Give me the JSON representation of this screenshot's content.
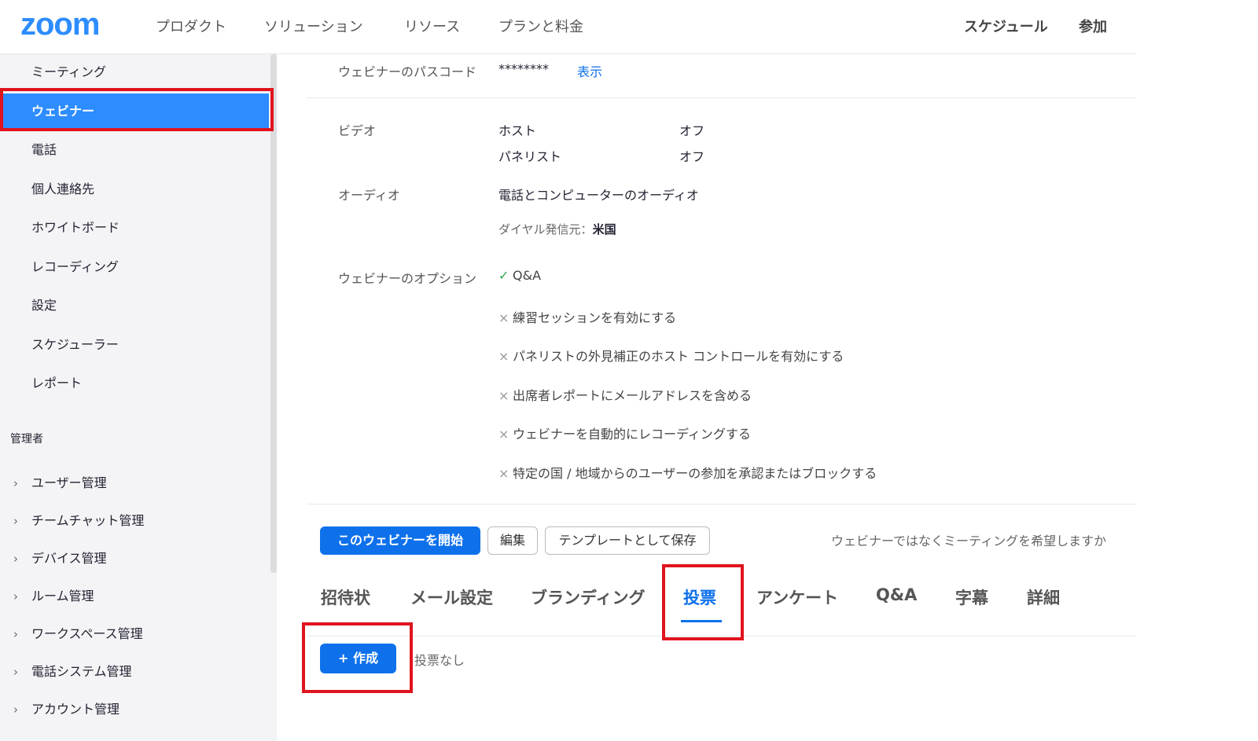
{
  "header": {
    "logo": "zoom",
    "nav": [
      "プロダクト",
      "ソリューション",
      "リソース",
      "プランと料金"
    ],
    "right": [
      "スケジュール",
      "参加"
    ]
  },
  "sidebar": {
    "items": [
      "ミーティング",
      "ウェビナー",
      "電話",
      "個人連絡先",
      "ホワイトボード",
      "レコーディング",
      "設定",
      "スケジューラー",
      "レポート"
    ],
    "active_item": "ウェビナー",
    "admin_heading": "管理者",
    "admin_items": [
      "ユーザー管理",
      "チームチャット管理",
      "デバイス管理",
      "ルーム管理",
      "ワークスペース管理",
      "電話システム管理",
      "アカウント管理"
    ]
  },
  "details": {
    "passcode_label": "ウェビナーのパスコード",
    "passcode_value": "********",
    "passcode_show": "表示",
    "video_label": "ビデオ",
    "video_host_label": "ホスト",
    "video_host_value": "オフ",
    "video_panelist_label": "パネリスト",
    "video_panelist_value": "オフ",
    "audio_label": "オーディオ",
    "audio_value": "電話とコンピューターのオーディオ",
    "dial_from_label": "ダイヤル発信元：",
    "dial_from_value": "米国",
    "options_label": "ウェビナーのオプション",
    "options": [
      {
        "enabled": true,
        "text": "Q&A"
      },
      {
        "enabled": false,
        "text": "練習セッションを有効にする"
      },
      {
        "enabled": false,
        "text": "パネリストの外見補正のホスト コントロールを有効にする"
      },
      {
        "enabled": false,
        "text": "出席者レポートにメールアドレスを含める"
      },
      {
        "enabled": false,
        "text": "ウェビナーを自動的にレコーディングする"
      },
      {
        "enabled": false,
        "text": "特定の国 / 地域からのユーザーの参加を承認またはブロックする"
      }
    ]
  },
  "actions": {
    "start": "このウェビナーを開始",
    "edit": "編集",
    "save_template": "テンプレートとして保存",
    "prefer_meeting": "ウェビナーではなくミーティングを希望しますか"
  },
  "tabs": [
    "招待状",
    "メール設定",
    "ブランディング",
    "投票",
    "アンケート",
    "Q&A",
    "字幕",
    "詳細"
  ],
  "active_tab": "投票",
  "polls": {
    "create_label": "作成",
    "create_icon": "+",
    "empty_text": "投票なし"
  },
  "colors": {
    "accent": "#0e71eb",
    "brand": "#2D8CFF",
    "highlight": "#e0141e"
  }
}
